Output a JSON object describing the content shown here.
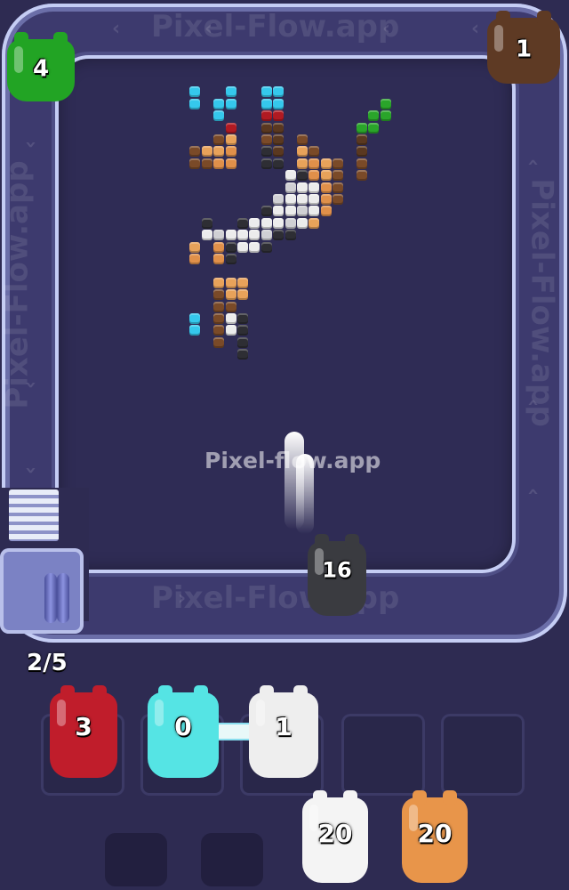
{
  "watermark": {
    "center": "Pixel-flow.app",
    "track_top": "Pixel-Flow.app",
    "track_bottom": "Pixel-Flow.app",
    "track_left": "Pixel-Flow.app",
    "track_right": "Pixel-Flow.app"
  },
  "progress": "2/5",
  "track_creatures": [
    {
      "id": "green",
      "count": "4",
      "color": "#22a424"
    },
    {
      "id": "brown",
      "count": "1",
      "color": "#5e3a24"
    },
    {
      "id": "black",
      "count": "16",
      "color": "#3a3b40"
    }
  ],
  "slots": [
    {
      "count": "3",
      "color": "#c01d2b"
    },
    {
      "count": "0",
      "color": "#55e4e4"
    },
    {
      "count": "1",
      "color": "#eeeeee"
    },
    {
      "count": "",
      "color": ""
    },
    {
      "count": "",
      "color": ""
    }
  ],
  "queue": [
    {
      "count": "20",
      "color": "#f4f4f4"
    },
    {
      "count": "20",
      "color": "#e8954a"
    }
  ],
  "palette": {
    "C": "#35c8ec",
    "R": "#b01a22",
    "O": "#e0904a",
    "T": "#e8a25a",
    "B": "#7a4a28",
    "D": "#5a3820",
    "K": "#2e2e34",
    "W": "#ececec",
    "G": "#d0d0d4",
    "N": "#2aa52a"
  },
  "pixel_art": [
    {
      "c": 11,
      "r": 1,
      "k": "C"
    },
    {
      "c": 11,
      "r": 2,
      "k": "C"
    },
    {
      "c": 14,
      "r": 1,
      "k": "C"
    },
    {
      "c": 14,
      "r": 2,
      "k": "C"
    },
    {
      "c": 13,
      "r": 2,
      "k": "C"
    },
    {
      "c": 13,
      "r": 3,
      "k": "C"
    },
    {
      "c": 17,
      "r": 1,
      "k": "C"
    },
    {
      "c": 18,
      "r": 1,
      "k": "C"
    },
    {
      "c": 17,
      "r": 2,
      "k": "C"
    },
    {
      "c": 18,
      "r": 2,
      "k": "C"
    },
    {
      "c": 17,
      "r": 3,
      "k": "R"
    },
    {
      "c": 18,
      "r": 3,
      "k": "R"
    },
    {
      "c": 14,
      "r": 4,
      "k": "R"
    },
    {
      "c": 17,
      "r": 4,
      "k": "D"
    },
    {
      "c": 18,
      "r": 4,
      "k": "D"
    },
    {
      "c": 14,
      "r": 5,
      "k": "T"
    },
    {
      "c": 13,
      "r": 5,
      "k": "B"
    },
    {
      "c": 17,
      "r": 5,
      "k": "B"
    },
    {
      "c": 18,
      "r": 5,
      "k": "D"
    },
    {
      "c": 20,
      "r": 5,
      "k": "B"
    },
    {
      "c": 25,
      "r": 5,
      "k": "D"
    },
    {
      "c": 26,
      "r": 3,
      "k": "N"
    },
    {
      "c": 26,
      "r": 4,
      "k": "N"
    },
    {
      "c": 25,
      "r": 4,
      "k": "N"
    },
    {
      "c": 27,
      "r": 2,
      "k": "N"
    },
    {
      "c": 27,
      "r": 3,
      "k": "N"
    },
    {
      "c": 11,
      "r": 6,
      "k": "B"
    },
    {
      "c": 12,
      "r": 6,
      "k": "T"
    },
    {
      "c": 13,
      "r": 6,
      "k": "T"
    },
    {
      "c": 14,
      "r": 6,
      "k": "O"
    },
    {
      "c": 17,
      "r": 6,
      "k": "K"
    },
    {
      "c": 18,
      "r": 6,
      "k": "D"
    },
    {
      "c": 20,
      "r": 6,
      "k": "T"
    },
    {
      "c": 21,
      "r": 6,
      "k": "B"
    },
    {
      "c": 25,
      "r": 6,
      "k": "D"
    },
    {
      "c": 11,
      "r": 7,
      "k": "B"
    },
    {
      "c": 12,
      "r": 7,
      "k": "B"
    },
    {
      "c": 13,
      "r": 7,
      "k": "O"
    },
    {
      "c": 14,
      "r": 7,
      "k": "O"
    },
    {
      "c": 17,
      "r": 7,
      "k": "K"
    },
    {
      "c": 18,
      "r": 7,
      "k": "K"
    },
    {
      "c": 20,
      "r": 7,
      "k": "T"
    },
    {
      "c": 21,
      "r": 7,
      "k": "O"
    },
    {
      "c": 22,
      "r": 7,
      "k": "T"
    },
    {
      "c": 23,
      "r": 7,
      "k": "B"
    },
    {
      "c": 25,
      "r": 7,
      "k": "B"
    },
    {
      "c": 19,
      "r": 8,
      "k": "W"
    },
    {
      "c": 20,
      "r": 8,
      "k": "K"
    },
    {
      "c": 21,
      "r": 8,
      "k": "O"
    },
    {
      "c": 22,
      "r": 8,
      "k": "T"
    },
    {
      "c": 23,
      "r": 8,
      "k": "B"
    },
    {
      "c": 25,
      "r": 8,
      "k": "B"
    },
    {
      "c": 19,
      "r": 9,
      "k": "G"
    },
    {
      "c": 20,
      "r": 9,
      "k": "W"
    },
    {
      "c": 21,
      "r": 9,
      "k": "W"
    },
    {
      "c": 22,
      "r": 9,
      "k": "O"
    },
    {
      "c": 23,
      "r": 9,
      "k": "B"
    },
    {
      "c": 18,
      "r": 10,
      "k": "G"
    },
    {
      "c": 19,
      "r": 10,
      "k": "W"
    },
    {
      "c": 20,
      "r": 10,
      "k": "W"
    },
    {
      "c": 21,
      "r": 10,
      "k": "W"
    },
    {
      "c": 22,
      "r": 10,
      "k": "O"
    },
    {
      "c": 23,
      "r": 10,
      "k": "B"
    },
    {
      "c": 17,
      "r": 11,
      "k": "K"
    },
    {
      "c": 18,
      "r": 11,
      "k": "W"
    },
    {
      "c": 19,
      "r": 11,
      "k": "W"
    },
    {
      "c": 20,
      "r": 11,
      "k": "G"
    },
    {
      "c": 21,
      "r": 11,
      "k": "W"
    },
    {
      "c": 22,
      "r": 11,
      "k": "O"
    },
    {
      "c": 12,
      "r": 12,
      "k": "K"
    },
    {
      "c": 15,
      "r": 12,
      "k": "K"
    },
    {
      "c": 16,
      "r": 12,
      "k": "W"
    },
    {
      "c": 17,
      "r": 12,
      "k": "W"
    },
    {
      "c": 18,
      "r": 12,
      "k": "W"
    },
    {
      "c": 19,
      "r": 12,
      "k": "G"
    },
    {
      "c": 20,
      "r": 12,
      "k": "W"
    },
    {
      "c": 21,
      "r": 12,
      "k": "T"
    },
    {
      "c": 12,
      "r": 13,
      "k": "W"
    },
    {
      "c": 13,
      "r": 13,
      "k": "G"
    },
    {
      "c": 14,
      "r": 13,
      "k": "W"
    },
    {
      "c": 15,
      "r": 13,
      "k": "W"
    },
    {
      "c": 16,
      "r": 13,
      "k": "W"
    },
    {
      "c": 17,
      "r": 13,
      "k": "G"
    },
    {
      "c": 18,
      "r": 13,
      "k": "K"
    },
    {
      "c": 19,
      "r": 13,
      "k": "K"
    },
    {
      "c": 11,
      "r": 14,
      "k": "T"
    },
    {
      "c": 13,
      "r": 14,
      "k": "O"
    },
    {
      "c": 14,
      "r": 14,
      "k": "K"
    },
    {
      "c": 15,
      "r": 14,
      "k": "W"
    },
    {
      "c": 16,
      "r": 14,
      "k": "W"
    },
    {
      "c": 17,
      "r": 14,
      "k": "K"
    },
    {
      "c": 11,
      "r": 15,
      "k": "O"
    },
    {
      "c": 13,
      "r": 15,
      "k": "O"
    },
    {
      "c": 14,
      "r": 15,
      "k": "K"
    },
    {
      "c": 13,
      "r": 17,
      "k": "T"
    },
    {
      "c": 14,
      "r": 17,
      "k": "T"
    },
    {
      "c": 15,
      "r": 17,
      "k": "T"
    },
    {
      "c": 13,
      "r": 18,
      "k": "B"
    },
    {
      "c": 14,
      "r": 18,
      "k": "T"
    },
    {
      "c": 15,
      "r": 18,
      "k": "T"
    },
    {
      "c": 13,
      "r": 19,
      "k": "B"
    },
    {
      "c": 14,
      "r": 19,
      "k": "B"
    },
    {
      "c": 11,
      "r": 20,
      "k": "C"
    },
    {
      "c": 13,
      "r": 20,
      "k": "B"
    },
    {
      "c": 14,
      "r": 20,
      "k": "W"
    },
    {
      "c": 15,
      "r": 20,
      "k": "K"
    },
    {
      "c": 11,
      "r": 21,
      "k": "C"
    },
    {
      "c": 13,
      "r": 21,
      "k": "B"
    },
    {
      "c": 14,
      "r": 21,
      "k": "W"
    },
    {
      "c": 15,
      "r": 21,
      "k": "K"
    },
    {
      "c": 13,
      "r": 22,
      "k": "B"
    },
    {
      "c": 15,
      "r": 22,
      "k": "K"
    },
    {
      "c": 15,
      "r": 23,
      "k": "K"
    }
  ]
}
